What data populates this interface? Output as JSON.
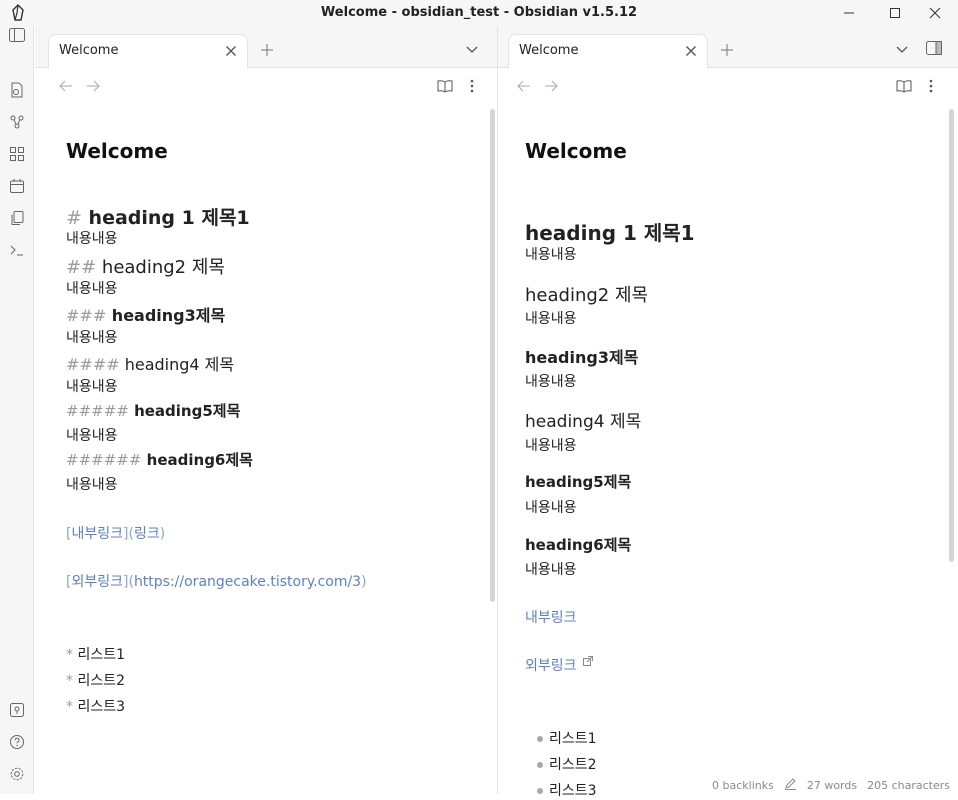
{
  "window": {
    "title": "Welcome - obsidian_test - Obsidian v1.5.12"
  },
  "ribbon": {
    "top_icons": [
      "file-search-icon",
      "graph-icon",
      "blocks-icon",
      "calendar-icon",
      "copy-icon",
      "terminal-icon"
    ],
    "bottom_icons": [
      "vault-icon",
      "help-icon",
      "settings-icon"
    ]
  },
  "left_pane": {
    "tab_label": "Welcome",
    "doc_title": "Welcome",
    "source": [
      {
        "kind": "h1",
        "mark": "#",
        "text": "heading 1 제목1"
      },
      {
        "kind": "body",
        "text": "내용내용"
      },
      {
        "kind": "h2",
        "mark": "##",
        "text": "heading2 제목"
      },
      {
        "kind": "body",
        "text": "내용내용"
      },
      {
        "kind": "h3",
        "mark": "###",
        "text": "heading3제목"
      },
      {
        "kind": "body",
        "text": "내용내용"
      },
      {
        "kind": "h4",
        "mark": "####",
        "text": "heading4 제목"
      },
      {
        "kind": "body",
        "text": "내용내용"
      },
      {
        "kind": "h5",
        "mark": "#####",
        "text": "heading5제목"
      },
      {
        "kind": "body",
        "text": "내용내용"
      },
      {
        "kind": "h6",
        "mark": "######",
        "text": "heading6제목"
      },
      {
        "kind": "body",
        "text": "내용내용"
      }
    ],
    "internal_link": {
      "open": "[",
      "text": "내부링크",
      "mid": "](",
      "target": "링크",
      "close": ")"
    },
    "external_link": {
      "open": "[",
      "text": "외부링크",
      "mid": "](",
      "target": "https://orangecake.tistory.com/3",
      "close": ")"
    },
    "list": [
      {
        "mark": "*",
        "text": "리스트1"
      },
      {
        "mark": "*",
        "text": "리스트2"
      },
      {
        "mark": "*",
        "text": "리스트3"
      }
    ]
  },
  "right_pane": {
    "tab_label": "Welcome",
    "doc_title": "Welcome",
    "rendered": [
      {
        "kind": "rh1",
        "text": "heading 1 제목1"
      },
      {
        "kind": "body",
        "text": "내용내용"
      },
      {
        "kind": "rh2",
        "text": "heading2 제목"
      },
      {
        "kind": "body",
        "text": "내용내용"
      },
      {
        "kind": "rh3",
        "text": "heading3제목"
      },
      {
        "kind": "body",
        "text": "내용내용"
      },
      {
        "kind": "rh4",
        "text": "heading4 제목"
      },
      {
        "kind": "body",
        "text": "내용내용"
      },
      {
        "kind": "rh5",
        "text": "heading5제목"
      },
      {
        "kind": "body",
        "text": "내용내용"
      },
      {
        "kind": "rh6",
        "text": "heading6제목"
      },
      {
        "kind": "body",
        "text": "내용내용"
      }
    ],
    "internal_link": "내부링크",
    "external_link": "외부링크",
    "list": [
      "리스트1",
      "리스트2",
      "리스트3"
    ]
  },
  "status": {
    "backlinks": "0 backlinks",
    "words": "27 words",
    "characters": "205 characters"
  },
  "colors": {
    "link": "#5b7fd6",
    "markup": "#9a9a9a",
    "chrome": "#f6f6f6"
  }
}
